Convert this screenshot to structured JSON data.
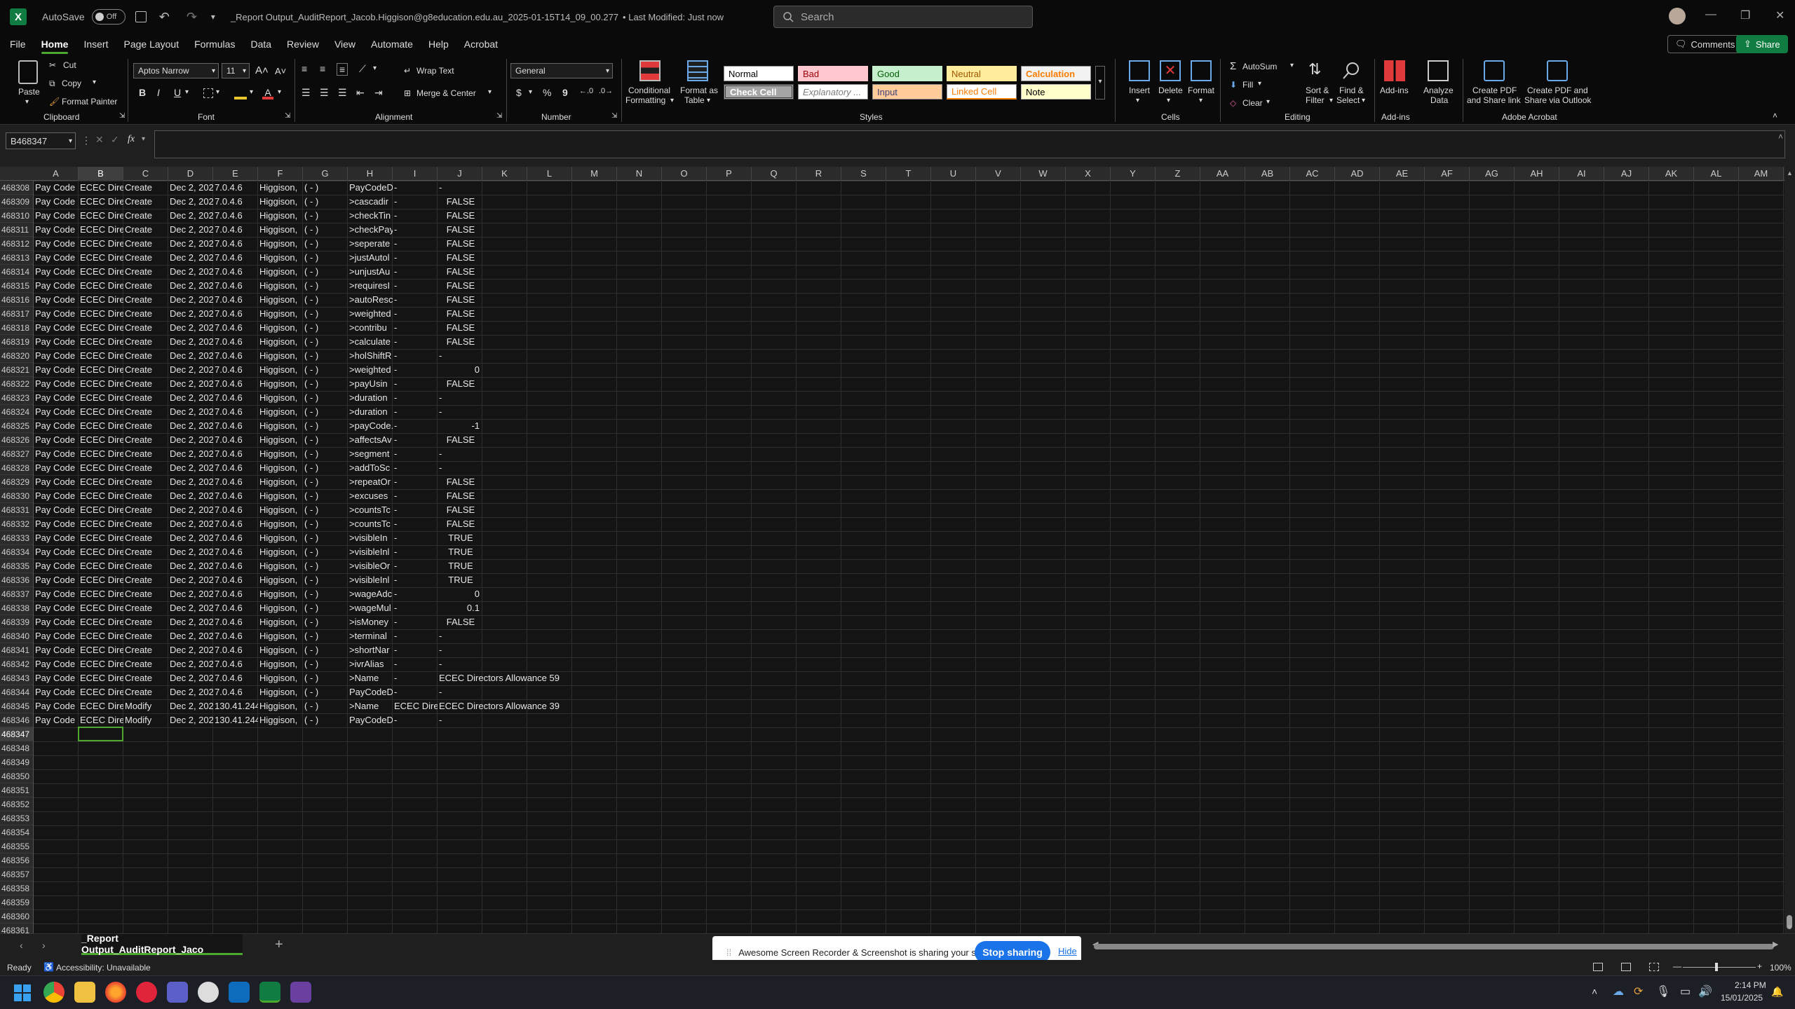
{
  "title_bar": {
    "autosave_label": "AutoSave",
    "autosave_state": "Off",
    "doc_title": "_Report Output_AuditReport_Jacob.Higgison@g8education.edu.au_2025-01-15T14_09_00.277",
    "modified": "• Last Modified: Just now",
    "search_placeholder": "Search"
  },
  "menu": [
    "File",
    "Home",
    "Insert",
    "Page Layout",
    "Formulas",
    "Data",
    "Review",
    "View",
    "Automate",
    "Help",
    "Acrobat"
  ],
  "top_buttons": {
    "comments": "Comments",
    "share": "Share"
  },
  "ribbon": {
    "clipboard": {
      "paste": "Paste",
      "cut": "Cut",
      "copy": "Copy",
      "format_painter": "Format Painter",
      "label": "Clipboard"
    },
    "font": {
      "name": "Aptos Narrow",
      "size": "11",
      "bold": "B",
      "italic": "I",
      "underline": "U",
      "label": "Font"
    },
    "alignment": {
      "wrap": "Wrap Text",
      "merge": "Merge & Center",
      "label": "Alignment"
    },
    "number": {
      "format": "General",
      "currency": "$",
      "percent": "%",
      "comma": "9",
      "label": "Number"
    },
    "styles": {
      "conditional_1": "Conditional",
      "conditional_2": "Formatting",
      "format_table_1": "Format as",
      "format_table_2": "Table",
      "cells": [
        "Normal",
        "Bad",
        "Good",
        "Neutral",
        "Calculation",
        "Check Cell",
        "Explanatory ...",
        "Input",
        "Linked Cell",
        "Note"
      ],
      "label": "Styles"
    },
    "cells": {
      "insert": "Insert",
      "delete": "Delete",
      "format": "Format",
      "label": "Cells"
    },
    "editing": {
      "autosum": "AutoSum",
      "fill": "Fill",
      "clear": "Clear",
      "sort_1": "Sort &",
      "sort_2": "Filter",
      "find_1": "Find &",
      "find_2": "Select",
      "label": "Editing"
    },
    "addins": {
      "addins": "Add-ins",
      "analyze_1": "Analyze",
      "analyze_2": "Data",
      "label": "Add-ins"
    },
    "acrobat": {
      "pdf_link_1": "Create PDF",
      "pdf_link_2": "and Share link",
      "pdf_outlook_1": "Create PDF and",
      "pdf_outlook_2": "Share via Outlook",
      "label": "Adobe Acrobat"
    }
  },
  "formula_bar": {
    "name_box": "B468347",
    "fx": "fx"
  },
  "columns": [
    "A",
    "B",
    "C",
    "D",
    "E",
    "F",
    "G",
    "H",
    "I",
    "J",
    "K",
    "L",
    "M",
    "N",
    "O",
    "P",
    "Q",
    "R",
    "S",
    "T",
    "U",
    "V",
    "W",
    "X",
    "Y",
    "Z",
    "AA",
    "AB",
    "AC",
    "AD",
    "AE",
    "AF",
    "AG",
    "AH",
    "AI",
    "AJ",
    "AK",
    "AL",
    "AM"
  ],
  "selected_column": "B",
  "selected_row": "468347",
  "row_numbers": [
    "468308",
    "468309",
    "468310",
    "468311",
    "468312",
    "468313",
    "468314",
    "468315",
    "468316",
    "468317",
    "468318",
    "468319",
    "468320",
    "468321",
    "468322",
    "468323",
    "468324",
    "468325",
    "468326",
    "468327",
    "468328",
    "468329",
    "468330",
    "468331",
    "468332",
    "468333",
    "468334",
    "468335",
    "468336",
    "468337",
    "468338",
    "468339",
    "468340",
    "468341",
    "468342",
    "468343",
    "468344",
    "468345",
    "468346",
    "468347",
    "468348",
    "468349",
    "468350",
    "468351",
    "468352",
    "468353",
    "468354",
    "468355",
    "468356",
    "468357",
    "468358",
    "468359",
    "468360",
    "468361"
  ],
  "rows": [
    {
      "A": "Pay Code",
      "B": "ECEC Dire",
      "C": "Create",
      "D": "Dec 2, 202",
      "E": "7.0.4.6",
      "F": "Higgison,",
      "G": "( - )",
      "H": "PayCodeD",
      "I": "-",
      "J": "-"
    },
    {
      "A": "Pay Code",
      "B": "ECEC Dire",
      "C": "Create",
      "D": "Dec 2, 202",
      "E": "7.0.4.6",
      "F": "Higgison,",
      "G": "( - )",
      "H": ">cascadir",
      "I": "-",
      "J": "FALSE"
    },
    {
      "A": "Pay Code",
      "B": "ECEC Dire",
      "C": "Create",
      "D": "Dec 2, 202",
      "E": "7.0.4.6",
      "F": "Higgison,",
      "G": "( - )",
      "H": ">checkTin",
      "I": "-",
      "J": "FALSE"
    },
    {
      "A": "Pay Code",
      "B": "ECEC Dire",
      "C": "Create",
      "D": "Dec 2, 202",
      "E": "7.0.4.6",
      "F": "Higgison,",
      "G": "( - )",
      "H": ">checkPay",
      "I": "-",
      "J": "FALSE"
    },
    {
      "A": "Pay Code",
      "B": "ECEC Dire",
      "C": "Create",
      "D": "Dec 2, 202",
      "E": "7.0.4.6",
      "F": "Higgison,",
      "G": "( - )",
      "H": ">seperate",
      "I": "-",
      "J": "FALSE"
    },
    {
      "A": "Pay Code",
      "B": "ECEC Dire",
      "C": "Create",
      "D": "Dec 2, 202",
      "E": "7.0.4.6",
      "F": "Higgison,",
      "G": "( - )",
      "H": ">justAutol",
      "I": "-",
      "J": "FALSE"
    },
    {
      "A": "Pay Code",
      "B": "ECEC Dire",
      "C": "Create",
      "D": "Dec 2, 202",
      "E": "7.0.4.6",
      "F": "Higgison,",
      "G": "( - )",
      "H": ">unjustAu",
      "I": "-",
      "J": "FALSE"
    },
    {
      "A": "Pay Code",
      "B": "ECEC Dire",
      "C": "Create",
      "D": "Dec 2, 202",
      "E": "7.0.4.6",
      "F": "Higgison,",
      "G": "( - )",
      "H": ">requiresI",
      "I": "-",
      "J": "FALSE"
    },
    {
      "A": "Pay Code",
      "B": "ECEC Dire",
      "C": "Create",
      "D": "Dec 2, 202",
      "E": "7.0.4.6",
      "F": "Higgison,",
      "G": "( - )",
      "H": ">autoResc",
      "I": "-",
      "J": "FALSE"
    },
    {
      "A": "Pay Code",
      "B": "ECEC Dire",
      "C": "Create",
      "D": "Dec 2, 202",
      "E": "7.0.4.6",
      "F": "Higgison,",
      "G": "( - )",
      "H": ">weighted",
      "I": "-",
      "J": "FALSE"
    },
    {
      "A": "Pay Code",
      "B": "ECEC Dire",
      "C": "Create",
      "D": "Dec 2, 202",
      "E": "7.0.4.6",
      "F": "Higgison,",
      "G": "( - )",
      "H": ">contribu",
      "I": "-",
      "J": "FALSE"
    },
    {
      "A": "Pay Code",
      "B": "ECEC Dire",
      "C": "Create",
      "D": "Dec 2, 202",
      "E": "7.0.4.6",
      "F": "Higgison,",
      "G": "( - )",
      "H": ">calculate",
      "I": "-",
      "J": "FALSE"
    },
    {
      "A": "Pay Code",
      "B": "ECEC Dire",
      "C": "Create",
      "D": "Dec 2, 202",
      "E": "7.0.4.6",
      "F": "Higgison,",
      "G": "( - )",
      "H": ">holShiftR",
      "I": "-",
      "J": "-"
    },
    {
      "A": "Pay Code",
      "B": "ECEC Dire",
      "C": "Create",
      "D": "Dec 2, 202",
      "E": "7.0.4.6",
      "F": "Higgison,",
      "G": "( - )",
      "H": ">weighted",
      "I": "-",
      "J": "0",
      "Jnum": true
    },
    {
      "A": "Pay Code",
      "B": "ECEC Dire",
      "C": "Create",
      "D": "Dec 2, 202",
      "E": "7.0.4.6",
      "F": "Higgison,",
      "G": "( - )",
      "H": ">payUsin",
      "I": "-",
      "J": "FALSE"
    },
    {
      "A": "Pay Code",
      "B": "ECEC Dire",
      "C": "Create",
      "D": "Dec 2, 202",
      "E": "7.0.4.6",
      "F": "Higgison,",
      "G": "( - )",
      "H": ">duration",
      "I": "-",
      "J": "-"
    },
    {
      "A": "Pay Code",
      "B": "ECEC Dire",
      "C": "Create",
      "D": "Dec 2, 202",
      "E": "7.0.4.6",
      "F": "Higgison,",
      "G": "( - )",
      "H": ">duration",
      "I": "-",
      "J": "-"
    },
    {
      "A": "Pay Code",
      "B": "ECEC Dire",
      "C": "Create",
      "D": "Dec 2, 202",
      "E": "7.0.4.6",
      "F": "Higgison,",
      "G": "( - )",
      "H": ">payCode.",
      "I": "-",
      "J": "-1",
      "Jnum": true
    },
    {
      "A": "Pay Code",
      "B": "ECEC Dire",
      "C": "Create",
      "D": "Dec 2, 202",
      "E": "7.0.4.6",
      "F": "Higgison,",
      "G": "( - )",
      "H": ">affectsAv",
      "I": "-",
      "J": "FALSE"
    },
    {
      "A": "Pay Code",
      "B": "ECEC Dire",
      "C": "Create",
      "D": "Dec 2, 202",
      "E": "7.0.4.6",
      "F": "Higgison,",
      "G": "( - )",
      "H": ">segment",
      "I": "-",
      "J": "-"
    },
    {
      "A": "Pay Code",
      "B": "ECEC Dire",
      "C": "Create",
      "D": "Dec 2, 202",
      "E": "7.0.4.6",
      "F": "Higgison,",
      "G": "( - )",
      "H": ">addToSc",
      "I": "-",
      "J": "-"
    },
    {
      "A": "Pay Code",
      "B": "ECEC Dire",
      "C": "Create",
      "D": "Dec 2, 202",
      "E": "7.0.4.6",
      "F": "Higgison,",
      "G": "( - )",
      "H": ">repeatOr",
      "I": "-",
      "J": "FALSE"
    },
    {
      "A": "Pay Code",
      "B": "ECEC Dire",
      "C": "Create",
      "D": "Dec 2, 202",
      "E": "7.0.4.6",
      "F": "Higgison,",
      "G": "( - )",
      "H": ">excuses",
      "I": "-",
      "J": "FALSE"
    },
    {
      "A": "Pay Code",
      "B": "ECEC Dire",
      "C": "Create",
      "D": "Dec 2, 202",
      "E": "7.0.4.6",
      "F": "Higgison,",
      "G": "( - )",
      "H": ">countsTc",
      "I": "-",
      "J": "FALSE"
    },
    {
      "A": "Pay Code",
      "B": "ECEC Dire",
      "C": "Create",
      "D": "Dec 2, 202",
      "E": "7.0.4.6",
      "F": "Higgison,",
      "G": "( - )",
      "H": ">countsTc",
      "I": "-",
      "J": "FALSE"
    },
    {
      "A": "Pay Code",
      "B": "ECEC Dire",
      "C": "Create",
      "D": "Dec 2, 202",
      "E": "7.0.4.6",
      "F": "Higgison,",
      "G": "( - )",
      "H": ">visibleIn",
      "I": "-",
      "J": "TRUE"
    },
    {
      "A": "Pay Code",
      "B": "ECEC Dire",
      "C": "Create",
      "D": "Dec 2, 202",
      "E": "7.0.4.6",
      "F": "Higgison,",
      "G": "( - )",
      "H": ">visibleInl",
      "I": "-",
      "J": "TRUE"
    },
    {
      "A": "Pay Code",
      "B": "ECEC Dire",
      "C": "Create",
      "D": "Dec 2, 202",
      "E": "7.0.4.6",
      "F": "Higgison,",
      "G": "( - )",
      "H": ">visibleOr",
      "I": "-",
      "J": "TRUE"
    },
    {
      "A": "Pay Code",
      "B": "ECEC Dire",
      "C": "Create",
      "D": "Dec 2, 202",
      "E": "7.0.4.6",
      "F": "Higgison,",
      "G": "( - )",
      "H": ">visibleInl",
      "I": "-",
      "J": "TRUE"
    },
    {
      "A": "Pay Code",
      "B": "ECEC Dire",
      "C": "Create",
      "D": "Dec 2, 202",
      "E": "7.0.4.6",
      "F": "Higgison,",
      "G": "( - )",
      "H": ">wageAdc",
      "I": "-",
      "J": "0",
      "Jnum": true
    },
    {
      "A": "Pay Code",
      "B": "ECEC Dire",
      "C": "Create",
      "D": "Dec 2, 202",
      "E": "7.0.4.6",
      "F": "Higgison,",
      "G": "( - )",
      "H": ">wageMul",
      "I": "-",
      "J": "0.1",
      "Jnum": true
    },
    {
      "A": "Pay Code",
      "B": "ECEC Dire",
      "C": "Create",
      "D": "Dec 2, 202",
      "E": "7.0.4.6",
      "F": "Higgison,",
      "G": "( - )",
      "H": ">isMoney",
      "I": "-",
      "J": "FALSE"
    },
    {
      "A": "Pay Code",
      "B": "ECEC Dire",
      "C": "Create",
      "D": "Dec 2, 202",
      "E": "7.0.4.6",
      "F": "Higgison,",
      "G": "( - )",
      "H": ">terminal",
      "I": "-",
      "J": "-"
    },
    {
      "A": "Pay Code",
      "B": "ECEC Dire",
      "C": "Create",
      "D": "Dec 2, 202",
      "E": "7.0.4.6",
      "F": "Higgison,",
      "G": "( - )",
      "H": ">shortNar",
      "I": "-",
      "J": "-"
    },
    {
      "A": "Pay Code",
      "B": "ECEC Dire",
      "C": "Create",
      "D": "Dec 2, 202",
      "E": "7.0.4.6",
      "F": "Higgison,",
      "G": "( - )",
      "H": ">ivrAlias",
      "I": "-",
      "J": "-"
    },
    {
      "A": "Pay Code",
      "B": "ECEC Dire",
      "C": "Create",
      "D": "Dec 2, 202",
      "E": "7.0.4.6",
      "F": "Higgison,",
      "G": "( - )",
      "H": ">Name",
      "I": "-",
      "J": "ECEC Directors Allowance 59",
      "Jovf": true
    },
    {
      "A": "Pay Code",
      "B": "ECEC Dire",
      "C": "Create",
      "D": "Dec 2, 202",
      "E": "7.0.4.6",
      "F": "Higgison,",
      "G": "( - )",
      "H": "PayCodeD",
      "I": "-",
      "J": "-"
    },
    {
      "A": "Pay Code",
      "B": "ECEC Dire",
      "C": "Modify",
      "D": "Dec 2, 202",
      "E": "130.41.244",
      "F": "Higgison,",
      "G": "( - )",
      "H": ">Name",
      "I": "ECEC Direc",
      "J": "ECEC Directors Allowance 39",
      "Jovf": true
    },
    {
      "A": "Pay Code",
      "B": "ECEC Dire",
      "C": "Modify",
      "D": "Dec 2, 202",
      "E": "130.41.244",
      "F": "Higgison,",
      "G": "( - )",
      "H": "PayCodeD",
      "I": "-",
      "J": "-"
    }
  ],
  "sheet_tab": "_Report Output_AuditReport_Jaco",
  "share_banner": {
    "text": "Awesome Screen Recorder & Screenshot is sharing your screen.",
    "stop": "Stop sharing",
    "hide": "Hide"
  },
  "status": {
    "ready": "Ready",
    "accessibility": "Accessibility: Unavailable",
    "zoom": "100%"
  },
  "taskbar": {
    "time": "2:14 PM",
    "date": "15/01/2025"
  },
  "colors": {
    "accent": "#4ea72e",
    "excel_green": "#107c41",
    "share_blue": "#1a73e8"
  }
}
